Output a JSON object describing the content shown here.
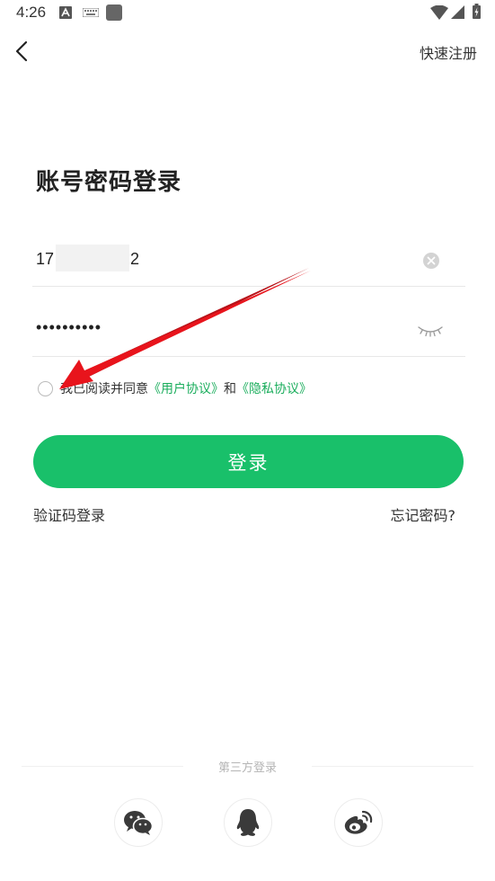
{
  "status_bar": {
    "time": "4:26",
    "icons": [
      "text-a-icon",
      "keyboard-icon",
      "app-square-icon",
      "wifi-icon",
      "signal-icon",
      "battery-icon"
    ]
  },
  "header": {
    "back_icon": "chevron-left-icon",
    "register_label": "快速注册"
  },
  "title": "账号密码登录",
  "phone_field": {
    "prefix": "17",
    "suffix": "2",
    "clear_icon": "clear-circle-icon"
  },
  "password_field": {
    "value": "••••••••••",
    "toggle_icon": "eye-closed-icon"
  },
  "agreement": {
    "prefix": "我已阅读并同意",
    "user_agreement": "《用户协议》",
    "conjunction": "和",
    "privacy_policy": "《隐私协议》",
    "checked": false
  },
  "login_button": "登录",
  "sms_login": "验证码登录",
  "forgot_password": "忘记密码?",
  "third_party": {
    "label": "第三方登录",
    "providers": [
      "wechat-icon",
      "qq-icon",
      "weibo-icon"
    ]
  },
  "colors": {
    "accent": "#19c06a",
    "link": "#1aad5c",
    "annotation": "#e8141c"
  }
}
